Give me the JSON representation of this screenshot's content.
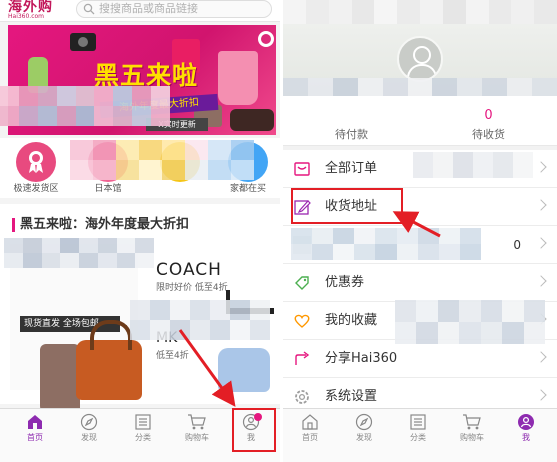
{
  "colors": {
    "brand": "#c2185b",
    "accent": "#e5177f",
    "tab_active": "#8e2bb0",
    "highlight": "#e31e25"
  },
  "left": {
    "header": {
      "logo_text": "海外购",
      "logo_domain": "Hai360.com",
      "search_placeholder": "搜搜商品或商品链接"
    },
    "banner": {
      "title": "黑五来啦",
      "subtitle": "海外年度最大折扣",
      "badge": "X实时更新"
    },
    "categories": [
      {
        "label": "极速发货区",
        "icon": "ribbon-icon",
        "color": "#e84a7f"
      },
      {
        "label": "日本馆",
        "icon": "japan-icon",
        "color": "#f06292"
      },
      {
        "label": "",
        "icon": "category-icon",
        "color": "#f5c518"
      },
      {
        "label": "家都在买",
        "icon": "trending-icon",
        "color": "#42a5f5"
      }
    ],
    "promo": {
      "title": "黑五来啦：海外年度最大折扣",
      "left_tag": "现货直发 全场包邮",
      "brand1": "COACH",
      "brand1_sub": "限时好价 低至4折",
      "brand2": "MK",
      "brand2_sub": "低至4折"
    },
    "tabs": [
      {
        "label": "首页",
        "icon": "home-icon",
        "active": true
      },
      {
        "label": "发现",
        "icon": "compass-icon",
        "active": false
      },
      {
        "label": "分类",
        "icon": "list-icon",
        "active": false
      },
      {
        "label": "购物车",
        "icon": "cart-icon",
        "active": false
      },
      {
        "label": "我",
        "icon": "profile-icon",
        "active": false
      }
    ]
  },
  "right": {
    "stats": [
      {
        "label": "待付款",
        "value": ""
      },
      {
        "label": "待收货",
        "value": "0"
      }
    ],
    "menu": [
      {
        "label": "全部订单",
        "icon": "orders-icon",
        "value": "",
        "icon_color": "#e5177f"
      },
      {
        "label": "收货地址",
        "icon": "edit-address-icon",
        "value": "",
        "icon_color": "#9c27b0"
      },
      {
        "label": "",
        "icon": "blurred-icon",
        "value": "0",
        "icon_color": "#cfd8dc"
      },
      {
        "label": "优惠券",
        "icon": "coupon-icon",
        "value": "",
        "icon_color": "#4caf50"
      },
      {
        "label": "我的收藏",
        "icon": "heart-icon",
        "value": "",
        "icon_color": "#ff9800"
      },
      {
        "label": "分享Hai360",
        "icon": "share-icon",
        "value": "",
        "icon_color": "#e5177f"
      },
      {
        "label": "系统设置",
        "icon": "settings-icon",
        "value": "",
        "icon_color": "#9e9e9e"
      }
    ],
    "tabs": [
      {
        "label": "首页",
        "icon": "home-icon",
        "active": false
      },
      {
        "label": "发现",
        "icon": "compass-icon",
        "active": false
      },
      {
        "label": "分类",
        "icon": "list-icon",
        "active": false
      },
      {
        "label": "购物车",
        "icon": "cart-icon",
        "active": false
      },
      {
        "label": "我",
        "icon": "profile-icon",
        "active": true
      }
    ]
  }
}
